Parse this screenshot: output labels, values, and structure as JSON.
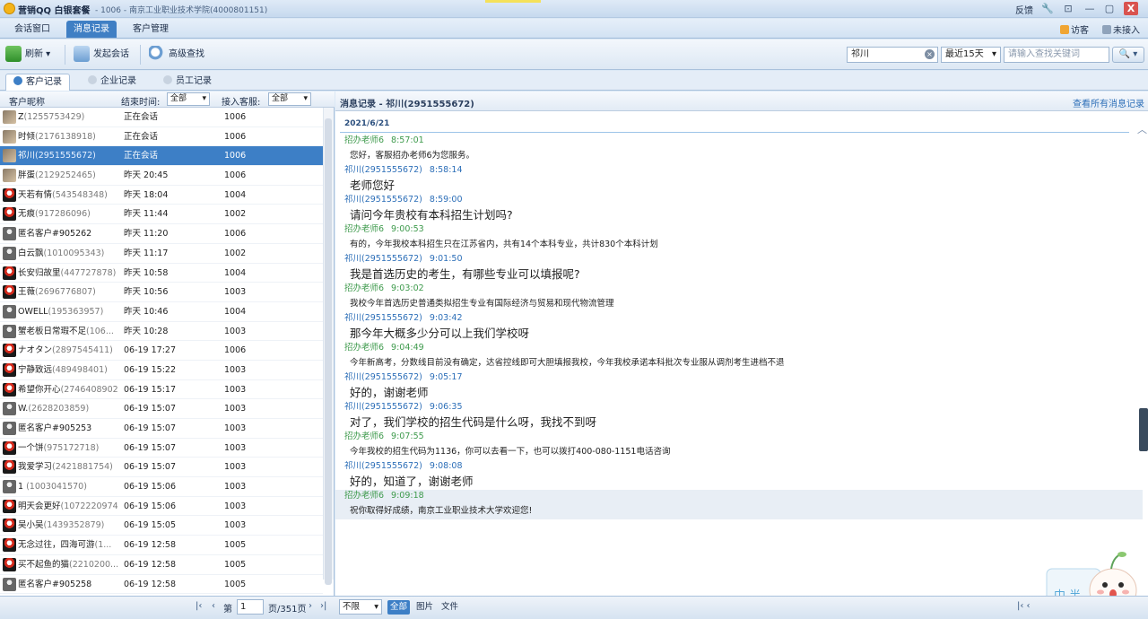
{
  "titlebar": {
    "app_name": "营销QQ 白银套餐",
    "window_info": " - 1006 - 南京工业职业技术学院(4000801151)",
    "feedback": "反馈",
    "min": "—",
    "restore": "▢",
    "close": "X"
  },
  "main_tabs": [
    {
      "label": "会话窗口"
    },
    {
      "label": "消息记录"
    },
    {
      "label": "客户管理"
    }
  ],
  "top_right": {
    "visitor": "访客",
    "status": "未接入"
  },
  "toolbar": {
    "refresh": "刷新",
    "start_chat": "发起会话",
    "advanced_search": "高级查找",
    "search_value": "祁川",
    "range": "最近15天",
    "keyword_placeholder": "请输入查找关键词",
    "clear": "×",
    "search_go": "🔍 ▾"
  },
  "sub_tabs": [
    {
      "label": "客户记录"
    },
    {
      "label": "企业记录"
    },
    {
      "label": "员工记录"
    }
  ],
  "list_header": {
    "nickname": "客户昵称",
    "end_time": "结束时间:",
    "end_time_filter": "全部",
    "agent": "接入客服:",
    "agent_filter": "全部"
  },
  "customers": [
    {
      "name": "Z",
      "qq": "(1255753429)",
      "time": "正在会话",
      "agent": "1006",
      "avatar": "photo"
    },
    {
      "name": "时倾",
      "qq": "(2176138918)",
      "time": "正在会话",
      "agent": "1006",
      "avatar": "photo"
    },
    {
      "name": "祁川",
      "qq": "(2951555672)",
      "time": "正在会话",
      "agent": "1006",
      "avatar": "photo"
    },
    {
      "name": "胖蛋",
      "qq": "(2129252465)",
      "time": "昨天 20:45",
      "agent": "1006",
      "avatar": "photo"
    },
    {
      "name": "天若有情",
      "qq": "(543548348)",
      "time": "昨天 18:04",
      "agent": "1004",
      "avatar": "peng"
    },
    {
      "name": "无痕",
      "qq": "(917286096)",
      "time": "昨天 11:44",
      "agent": "1002",
      "avatar": "peng"
    },
    {
      "name": "匿名客户#905262",
      "qq": "",
      "time": "昨天 11:20",
      "agent": "1006",
      "avatar": "gray"
    },
    {
      "name": "白云飘",
      "qq": "(1010095343)",
      "time": "昨天 11:17",
      "agent": "1002",
      "avatar": "gray"
    },
    {
      "name": "长安归故里",
      "qq": "(447727878)",
      "time": "昨天 10:58",
      "agent": "1004",
      "avatar": "peng"
    },
    {
      "name": "王薇",
      "qq": "(2696776807)",
      "time": "昨天 10:56",
      "agent": "1003",
      "avatar": "peng"
    },
    {
      "name": "OWELL",
      "qq": "(195363957)",
      "time": "昨天 10:46",
      "agent": "1004",
      "avatar": "gray"
    },
    {
      "name": "蟹老板日常瑕不足",
      "qq": "(106...",
      "time": "昨天 10:28",
      "agent": "1003",
      "avatar": "gray"
    },
    {
      "name": "ナオタン",
      "qq": "(2897545411)",
      "time": "06-19 17:27",
      "agent": "1006",
      "avatar": "peng"
    },
    {
      "name": "宁静致远",
      "qq": "(489498401)",
      "time": "06-19 15:22",
      "agent": "1003",
      "avatar": "peng"
    },
    {
      "name": "希望你开心",
      "qq": "(2746408902)",
      "time": "06-19 15:17",
      "agent": "1003",
      "avatar": "peng"
    },
    {
      "name": "W.",
      "qq": "(2628203859)",
      "time": "06-19 15:07",
      "agent": "1003",
      "avatar": "gray"
    },
    {
      "name": "匿名客户#905253",
      "qq": "",
      "time": "06-19 15:07",
      "agent": "1003",
      "avatar": "gray"
    },
    {
      "name": "一个饼",
      "qq": "(975172718)",
      "time": "06-19 15:07",
      "agent": "1003",
      "avatar": "peng"
    },
    {
      "name": "我爱学习",
      "qq": "(2421881754)",
      "time": "06-19 15:07",
      "agent": "1003",
      "avatar": "peng"
    },
    {
      "name": "1",
      "qq": " (1003041570)",
      "time": "06-19 15:06",
      "agent": "1003",
      "avatar": "gray"
    },
    {
      "name": "明天会更好",
      "qq": "(1072220974)",
      "time": "06-19 15:06",
      "agent": "1003",
      "avatar": "peng"
    },
    {
      "name": "吴小吴",
      "qq": "(1439352879)",
      "time": "06-19 15:05",
      "agent": "1003",
      "avatar": "peng"
    },
    {
      "name": "无念过往，四海可游",
      "qq": "(1...",
      "time": "06-19 12:58",
      "agent": "1005",
      "avatar": "peng"
    },
    {
      "name": "买不起鱼的猫",
      "qq": "(2210200...",
      "time": "06-19 12:58",
      "agent": "1005",
      "avatar": "peng"
    },
    {
      "name": "匿名客户#905258",
      "qq": "",
      "time": "06-19 12:58",
      "agent": "1005",
      "avatar": "gray"
    }
  ],
  "message_panel": {
    "title": "消息记录 - 祁川(2951555672)",
    "view_all": "查看所有消息记录",
    "date": "2021/6/21"
  },
  "messages": [
    {
      "role": "agent",
      "sender": "招办老师6",
      "time": "8:57:01",
      "text": "您好，客服招办老师6为您服务。"
    },
    {
      "role": "cust",
      "sender": "祁川(2951555672)",
      "time": "8:58:14",
      "text": "老师您好"
    },
    {
      "role": "cust",
      "sender": "祁川(2951555672)",
      "time": "8:59:00",
      "text": "请问今年贵校有本科招生计划吗?"
    },
    {
      "role": "agent",
      "sender": "招办老师6",
      "time": "9:00:53",
      "text": "有的，今年我校本科招生只在江苏省内，共有14个本科专业，共计830个本科计划"
    },
    {
      "role": "cust",
      "sender": "祁川(2951555672)",
      "time": "9:01:50",
      "text": "我是首选历史的考生，有哪些专业可以填报呢?"
    },
    {
      "role": "agent",
      "sender": "招办老师6",
      "time": "9:03:02",
      "text": "我校今年首选历史普通类拟招生专业有国际经济与贸易和现代物流管理"
    },
    {
      "role": "cust",
      "sender": "祁川(2951555672)",
      "time": "9:03:42",
      "text": "那今年大概多少分可以上我们学校呀"
    },
    {
      "role": "agent",
      "sender": "招办老师6",
      "time": "9:04:49",
      "text": "今年新高考，分数线目前没有确定，达省控线即可大胆填报我校，今年我校承诺本科批次专业服从调剂考生进档不退"
    },
    {
      "role": "cust",
      "sender": "祁川(2951555672)",
      "time": "9:05:17",
      "text": "好的，谢谢老师"
    },
    {
      "role": "cust",
      "sender": "祁川(2951555672)",
      "time": "9:06:35",
      "text": "对了，我们学校的招生代码是什么呀，我找不到呀"
    },
    {
      "role": "agent",
      "sender": "招办老师6",
      "time": "9:07:55",
      "text": "今年我校的招生代码为1136，你可以去看一下，也可以拨打400-080-1151电话咨询"
    },
    {
      "role": "cust",
      "sender": "祁川(2951555672)",
      "time": "9:08:08",
      "text": "好的，知道了，谢谢老师"
    },
    {
      "role": "agent",
      "sender": "招办老师6",
      "time": "9:09:18",
      "text": "祝你取得好成绩，南京工业职业技术大学欢迎您!",
      "highlight": true
    }
  ],
  "pagination": {
    "first": "|‹",
    "prev": "‹",
    "page_label": "第",
    "page_value": "1",
    "total": "页/351页",
    "next": "›",
    "last": "›|"
  },
  "filter_bar": {
    "type_select": "不限",
    "tabs": [
      {
        "label": "全部"
      },
      {
        "label": "图片"
      },
      {
        "label": "文件"
      }
    ],
    "right_nav": "|‹  ‹"
  },
  "mascot_text": "中 半",
  "colors": {
    "accent": "#3d7fc6",
    "agent_name": "#3e9a4c",
    "customer_name": "#2d6fb8",
    "penguin": "#d42a1c"
  }
}
